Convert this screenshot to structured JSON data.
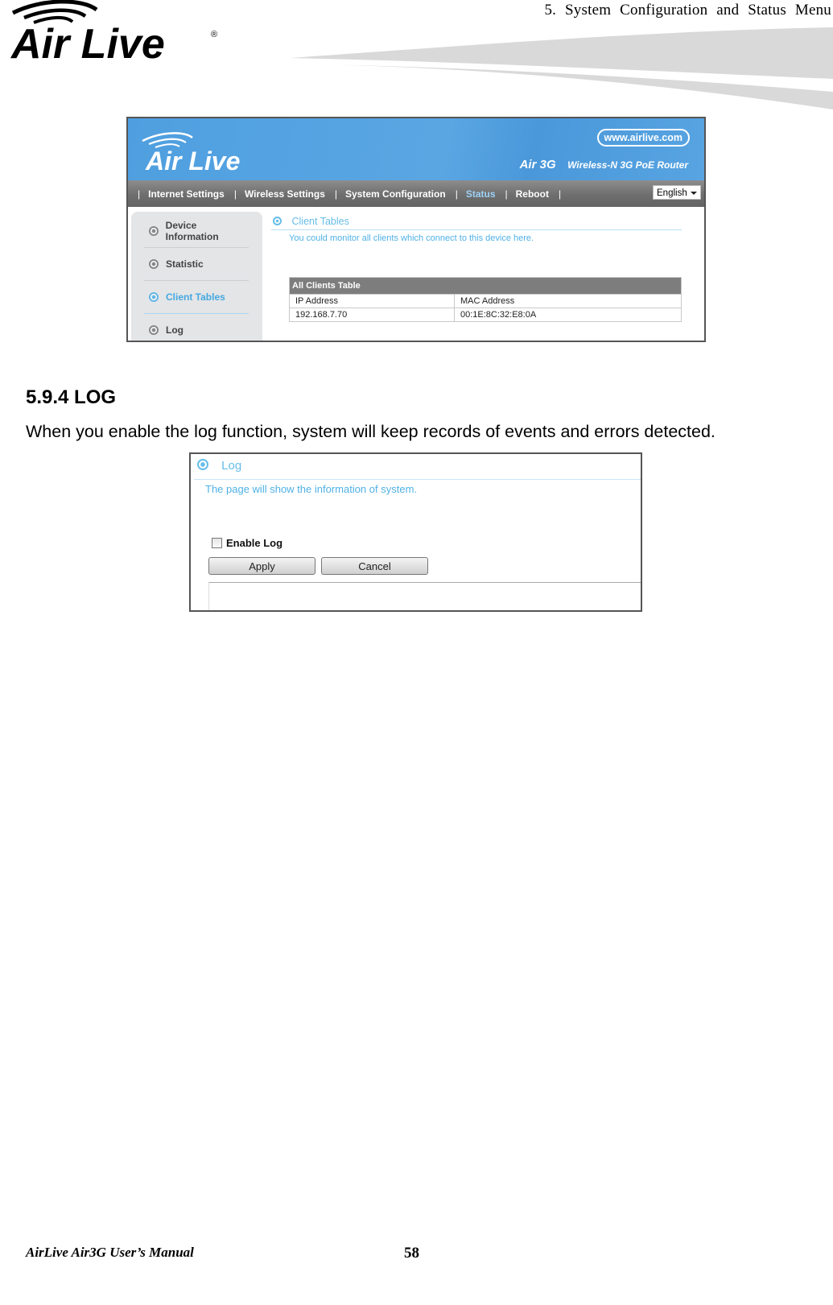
{
  "page_header": {
    "brand_logo_text": "Air Live",
    "chapter_title": "5. System Configuration and Status Menu"
  },
  "router_screenshot": {
    "brand_logo_text": "Air Live",
    "website": "www.airlive.com",
    "model": "Air 3G",
    "model_description": "Wireless-N 3G PoE Router",
    "nav": {
      "items": [
        {
          "label": "Internet Settings",
          "active": false
        },
        {
          "label": "Wireless Settings",
          "active": false
        },
        {
          "label": "System Configuration",
          "active": false
        },
        {
          "label": "Status",
          "active": true
        },
        {
          "label": "Reboot",
          "active": false
        }
      ],
      "language": "English"
    },
    "sidebar": {
      "items": [
        {
          "label": "Device Information",
          "active": false,
          "icon": "target-ring-icon"
        },
        {
          "label": "Statistic",
          "active": false,
          "icon": "target-ring-icon"
        },
        {
          "label": "Client Tables",
          "active": true,
          "icon": "target-ring-icon"
        },
        {
          "label": "Log",
          "active": false,
          "icon": "target-ring-icon"
        }
      ]
    },
    "content": {
      "title": "Client Tables",
      "description": "You could monitor all clients which connect to this device here.",
      "table": {
        "caption": "All Clients Table",
        "columns": [
          "IP Address",
          "MAC Address"
        ],
        "rows": [
          [
            "192.168.7.70",
            "00:1E:8C:32:E8:0A"
          ]
        ]
      }
    },
    "colors": {
      "banner_blue": "#55a2e1",
      "nav_gray": "#767676",
      "accent_light_blue": "#66bde8"
    }
  },
  "section": {
    "heading": "5.9.4 LOG",
    "body": "When you enable the log function, system will keep records of events and errors detected."
  },
  "log_screenshot": {
    "title": "Log",
    "description": "The page will show the information of system.",
    "enable_log_label": "Enable Log",
    "enable_log_checked": false,
    "apply_label": "Apply",
    "cancel_label": "Cancel"
  },
  "footer": {
    "manual_title": "AirLive Air3G User’s Manual",
    "page_number": "58"
  }
}
